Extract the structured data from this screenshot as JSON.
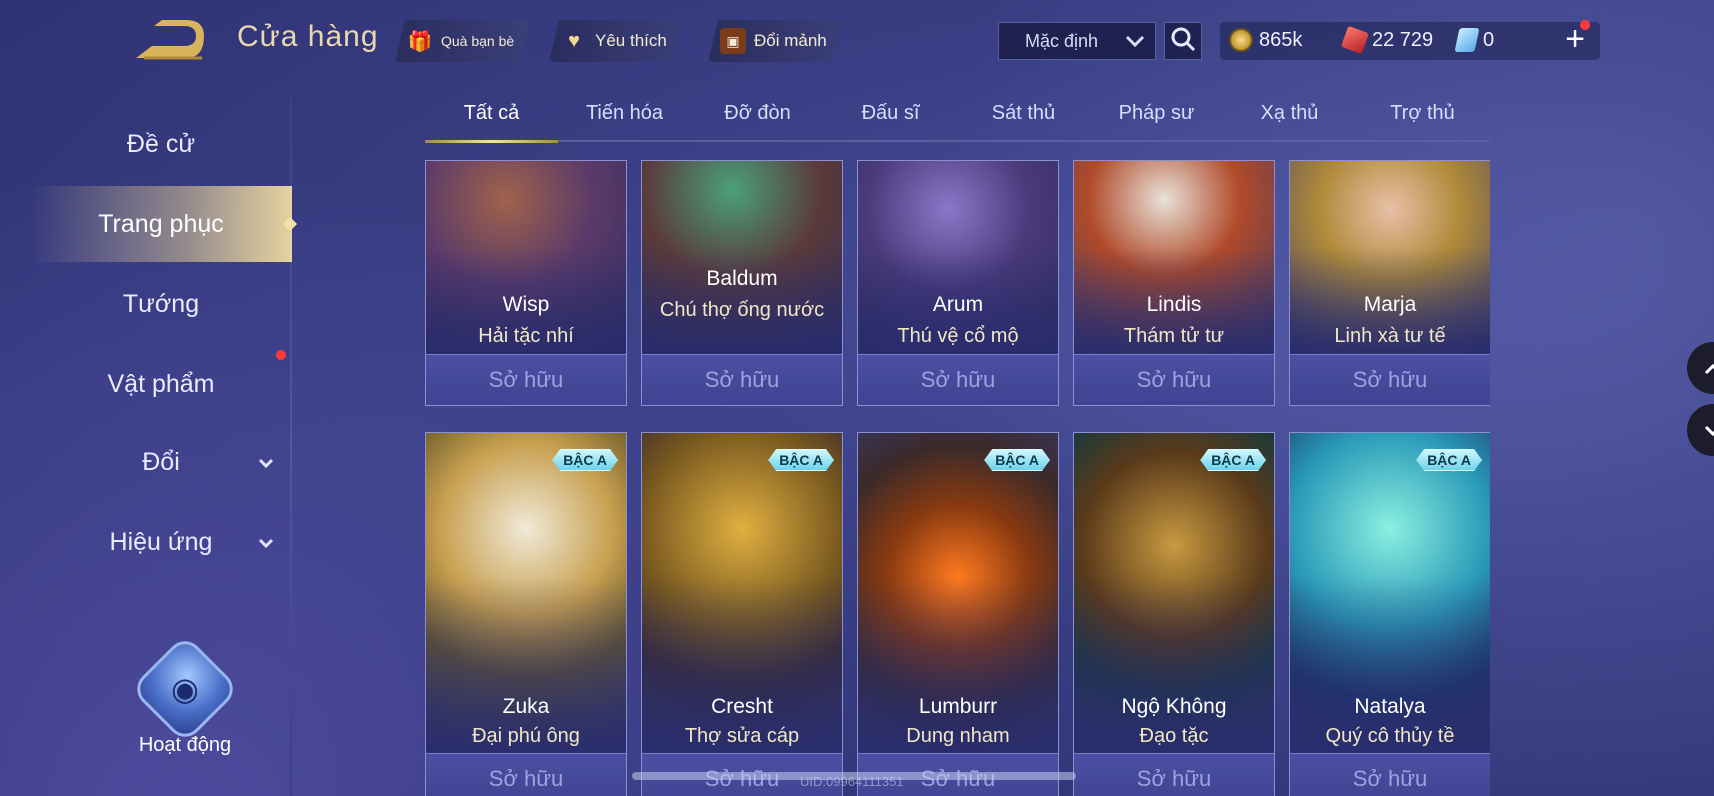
{
  "header": {
    "title": "Cửa hàng",
    "gift_label": "Quà bạn bè",
    "favorite_label": "Yêu thích",
    "exchange_label": "Đổi mảnh",
    "sort_label": "Mặc định",
    "coins": "865k",
    "vouchers": "22 729",
    "gems": "0"
  },
  "sidebar": {
    "items": [
      "Đề cử",
      "Trang phục",
      "Tướng",
      "Vật phẩm",
      "Đổi",
      "Hiệu ứng"
    ],
    "activity_label": "Hoạt động"
  },
  "tabs": [
    "Tất cả",
    "Tiến hóa",
    "Đỡ đòn",
    "Đấu sĩ",
    "Sát thủ",
    "Pháp sư",
    "Xạ thủ",
    "Trợ thủ"
  ],
  "owned_label": "Sở hữu",
  "rank_badge": "BẬC A",
  "row1": [
    {
      "hero": "Wisp",
      "skin": "Hải tặc nhí"
    },
    {
      "hero": "Baldum",
      "skin": "Chú thợ ống nước"
    },
    {
      "hero": "Arum",
      "skin": "Thú vệ cổ mộ"
    },
    {
      "hero": "Lindis",
      "skin": "Thám tử tư"
    },
    {
      "hero": "Marja",
      "skin": "Linh xà tư tế"
    }
  ],
  "row2": [
    {
      "hero": "Zuka",
      "skin": "Đại phú ông"
    },
    {
      "hero": "Cresht",
      "skin": "Thợ sửa cáp"
    },
    {
      "hero": "Lumburr",
      "skin": "Dung nham"
    },
    {
      "hero": "Ngộ Không",
      "skin": "Đạo tặc"
    },
    {
      "hero": "Natalya",
      "skin": "Quý cô thủy tề"
    }
  ],
  "uid": "UID:09964111351",
  "colors": {
    "accent_gold": "#e6d3a0",
    "badge_cyan": "#6fd2ea",
    "notification_red": "#ff3838"
  }
}
